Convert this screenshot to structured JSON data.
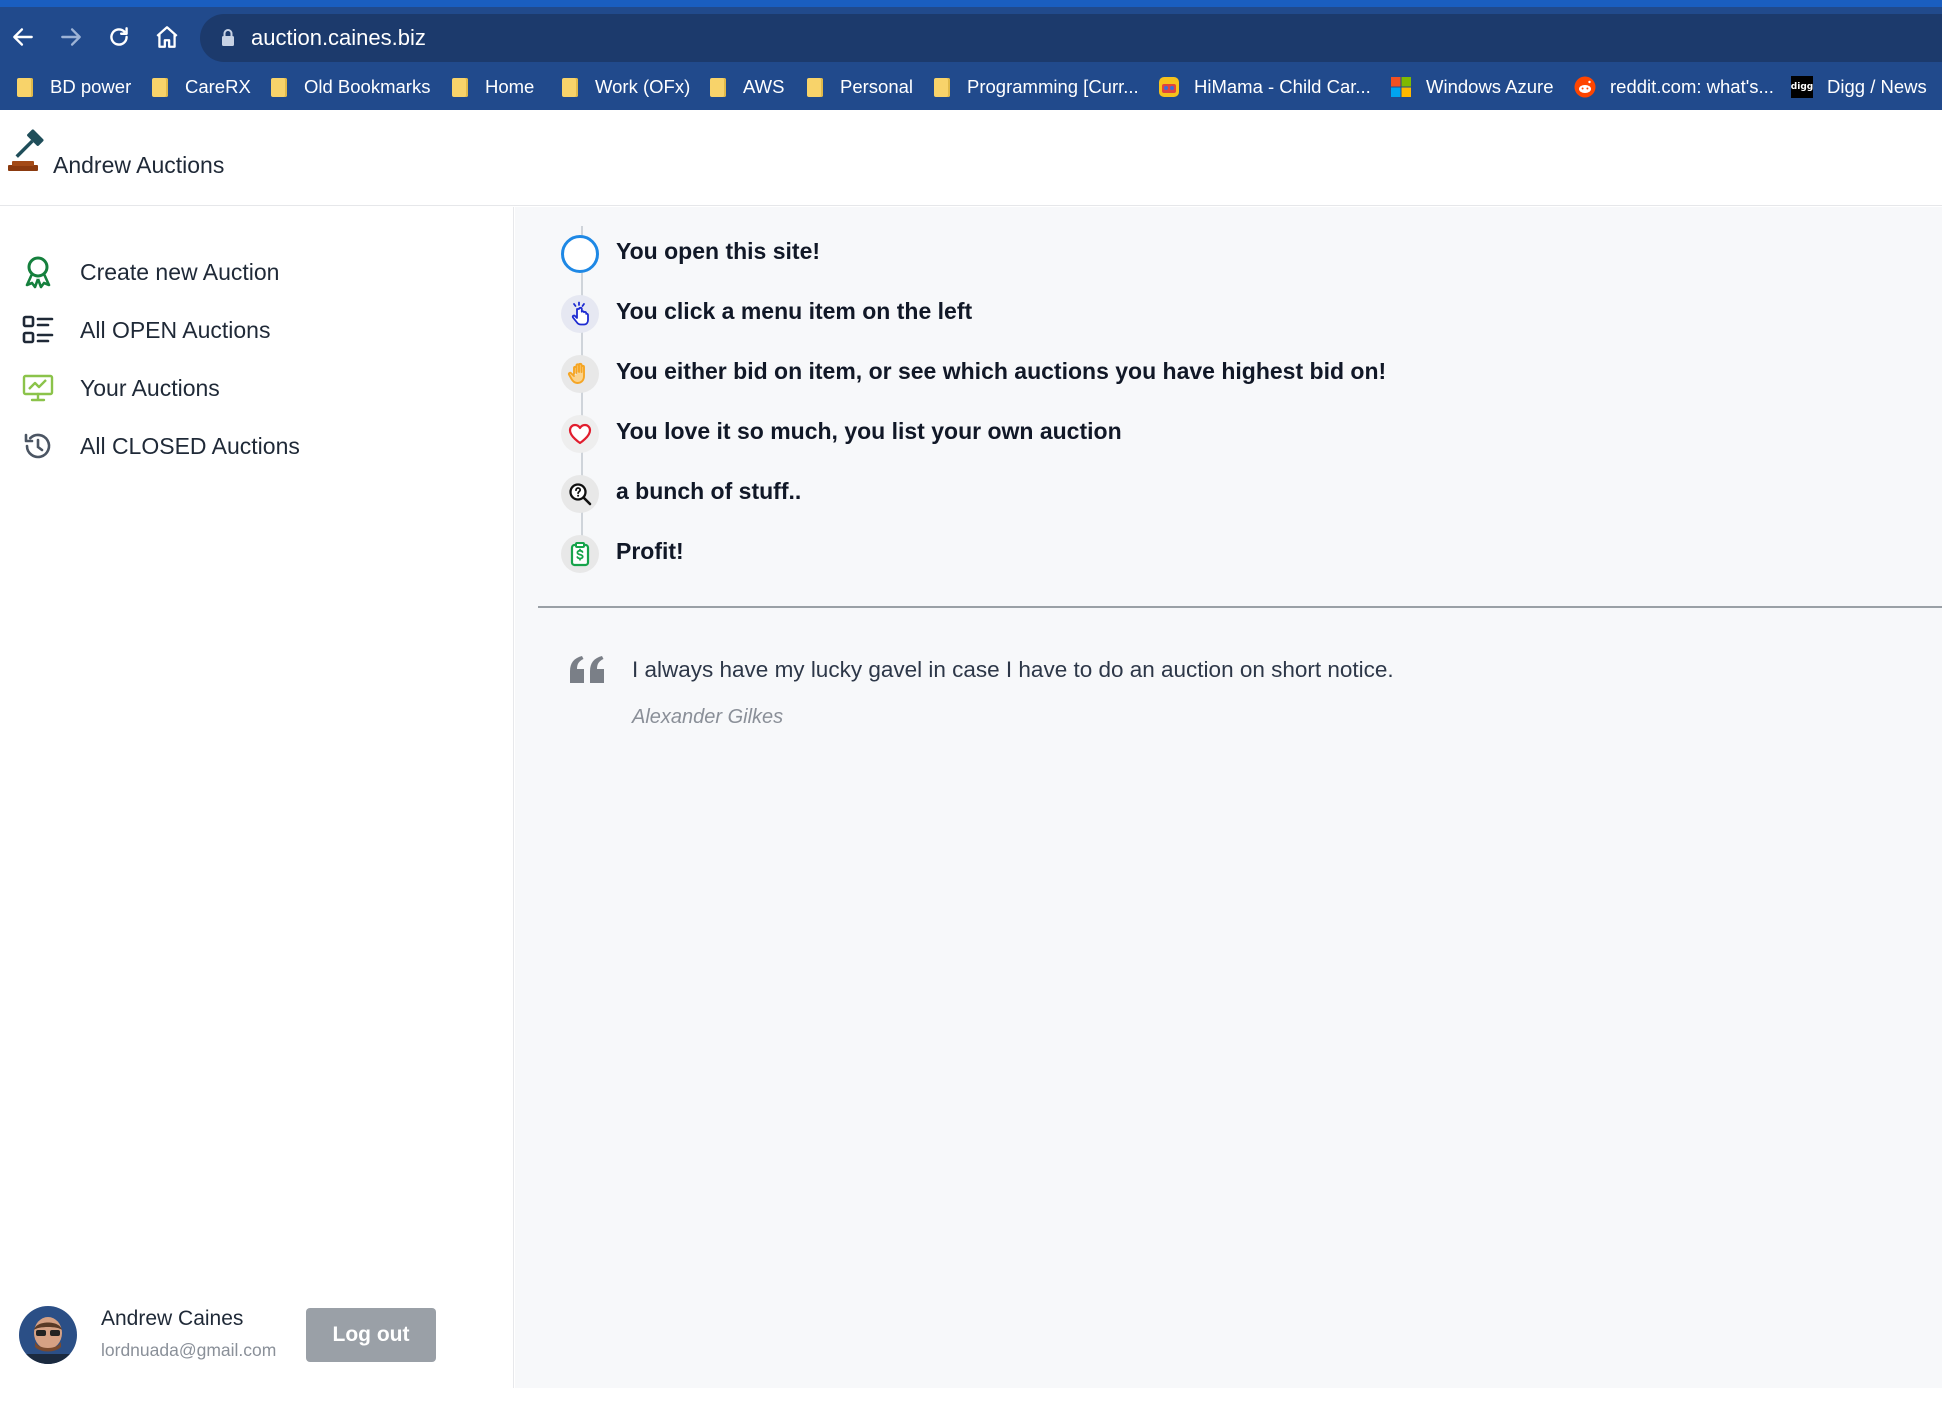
{
  "browser": {
    "url": "auction.caines.biz",
    "bookmarks": [
      {
        "label": "BD power",
        "icon": "folder-icon"
      },
      {
        "label": "CareRX",
        "icon": "folder-icon"
      },
      {
        "label": "Old Bookmarks",
        "icon": "folder-icon"
      },
      {
        "label": "Home",
        "icon": "folder-icon"
      },
      {
        "label": "Work (OFx)",
        "icon": "folder-icon"
      },
      {
        "label": "AWS",
        "icon": "folder-icon"
      },
      {
        "label": "Personal",
        "icon": "folder-icon"
      },
      {
        "label": "Programming [Curr...",
        "icon": "folder-icon"
      },
      {
        "label": "HiMama - Child Car...",
        "icon": "himama-icon"
      },
      {
        "label": "Windows Azure",
        "icon": "windows-icon"
      },
      {
        "label": "reddit.com: what's...",
        "icon": "reddit-icon"
      },
      {
        "label": "Digg / News",
        "icon": "digg-icon"
      }
    ],
    "digg_icon_text": "digg"
  },
  "app": {
    "title": "Andrew Auctions"
  },
  "sidebar": {
    "items": [
      {
        "label": "Create new Auction",
        "icon": "award-ribbon-icon"
      },
      {
        "label": "All OPEN Auctions",
        "icon": "list-icon"
      },
      {
        "label": "Your Auctions",
        "icon": "presentation-chart-icon"
      },
      {
        "label": "All CLOSED Auctions",
        "icon": "history-icon"
      }
    ],
    "user": {
      "name": "Andrew Caines",
      "email": "lordnuada@gmail.com",
      "logout_label": "Log out"
    }
  },
  "main": {
    "steps": [
      {
        "text": "You open this site!",
        "icon": "circle-icon"
      },
      {
        "text": "You click a menu item on the left",
        "icon": "pointer-click-icon"
      },
      {
        "text": "You either bid on item, or see which auctions you have highest bid on!",
        "icon": "hand-icon"
      },
      {
        "text": "You love it so much, you list your own auction",
        "icon": "heart-icon"
      },
      {
        "text": "a bunch of stuff..",
        "icon": "search-question-icon"
      },
      {
        "text": "Profit!",
        "icon": "money-clipboard-icon"
      }
    ],
    "quote": {
      "text": "I always have my lucky gavel in case I have to do an auction on short notice.",
      "author": "Alexander Gilkes"
    }
  },
  "colors": {
    "chrome": "#214a8c",
    "urlbar": "#1c3a6c",
    "award": "#15803d",
    "presentation": "#8bc34a",
    "timeline_blue": "#1e88e5",
    "hand_orange": "#f5a524",
    "heart_red": "#e11d2e",
    "money_green": "#16a34a",
    "logout_bg": "#9aa0a7"
  }
}
